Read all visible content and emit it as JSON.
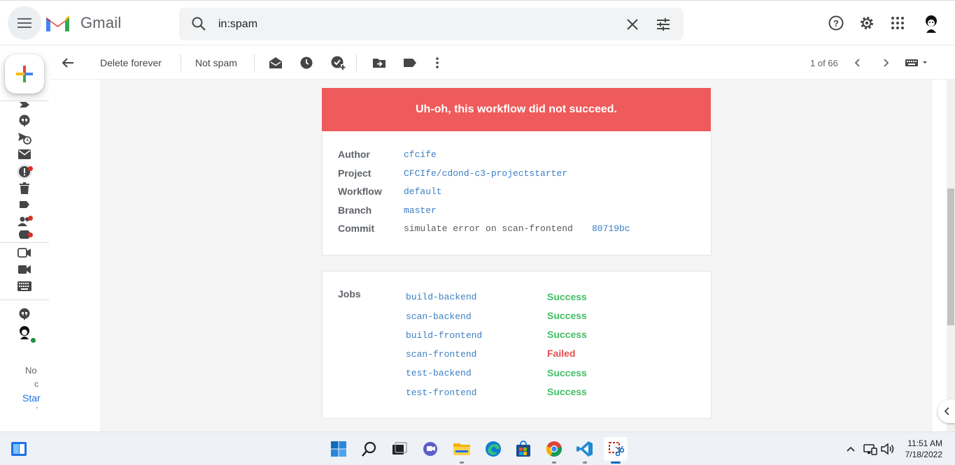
{
  "header": {
    "app_name": "Gmail",
    "search_value": "in:spam"
  },
  "toolbar": {
    "delete_forever": "Delete forever",
    "not_spam": "Not spam",
    "pagination": "1 of 66"
  },
  "sidebar_partial": {
    "line1": "No",
    "line2": "c",
    "link": "Star",
    "line4": "'"
  },
  "email": {
    "banner": "Uh-oh, this workflow did not succeed.",
    "details": [
      {
        "label": "Author",
        "value": "cfcife"
      },
      {
        "label": "Project",
        "value": "CFCIfe/cdond-c3-projectstarter"
      },
      {
        "label": "Workflow",
        "value": "default"
      },
      {
        "label": "Branch",
        "value": "master"
      }
    ],
    "commit_label": "Commit",
    "commit_message": "simulate error on scan-frontend",
    "commit_hash": "80719bc",
    "jobs_label": "Jobs",
    "jobs": [
      {
        "name": "build-backend",
        "status": "Success"
      },
      {
        "name": "scan-backend",
        "status": "Success"
      },
      {
        "name": "build-frontend",
        "status": "Success"
      },
      {
        "name": "scan-frontend",
        "status": "Failed"
      },
      {
        "name": "test-backend",
        "status": "Success"
      },
      {
        "name": "test-frontend",
        "status": "Success"
      }
    ]
  },
  "taskbar": {
    "time": "11:51 AM",
    "date": "7/18/2022"
  },
  "colors": {
    "banner": "#ef5a5a",
    "success": "#42be65",
    "failed": "#e55050",
    "link": "#3b7fc4"
  }
}
